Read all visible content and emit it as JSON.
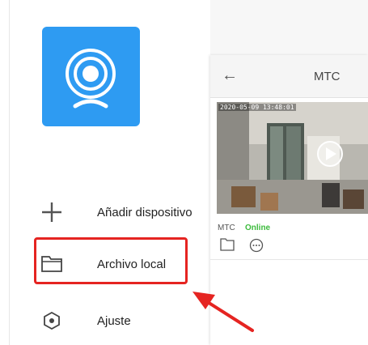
{
  "drawer": {
    "logo_icon": "camera-icon",
    "accent_color": "#2e9bf2",
    "items": [
      {
        "label": "Añadir dispositivo",
        "icon": "plus-icon"
      },
      {
        "label": "Archivo local",
        "icon": "folder-icon"
      },
      {
        "label": "Ajuste",
        "icon": "settings-hexagon-icon"
      }
    ]
  },
  "panel": {
    "title": "MTC",
    "back_icon": "back-arrow-icon",
    "device": {
      "timestamp": "2020-05-09 13:48:01",
      "name": "MTC",
      "status": "Online",
      "status_color": "#3dbb3d",
      "actions": [
        "folder-icon",
        "message-icon"
      ]
    }
  },
  "annotation": {
    "color": "#e52421"
  }
}
